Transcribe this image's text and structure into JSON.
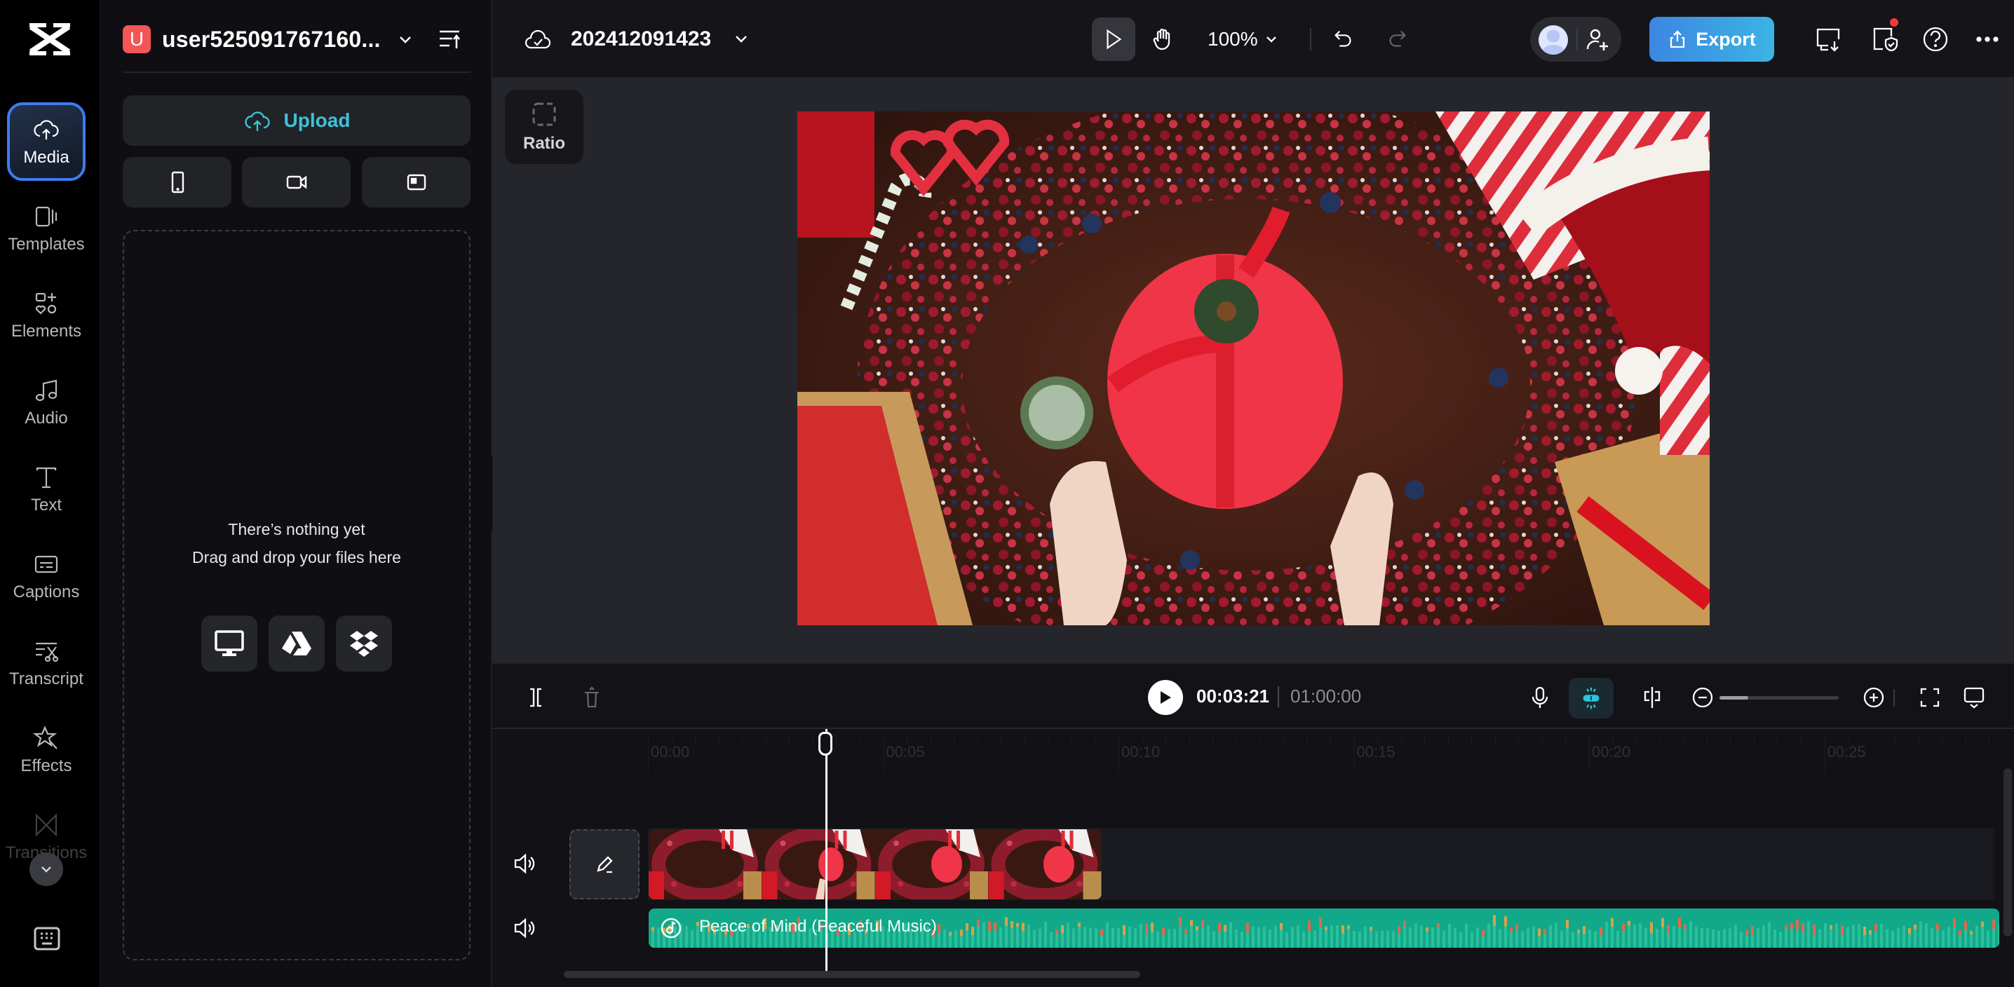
{
  "rail": {
    "items": [
      {
        "id": "media",
        "label": "Media",
        "active": true
      },
      {
        "id": "templates",
        "label": "Templates"
      },
      {
        "id": "elements",
        "label": "Elements"
      },
      {
        "id": "audio",
        "label": "Audio"
      },
      {
        "id": "text",
        "label": "Text"
      },
      {
        "id": "captions",
        "label": "Captions"
      },
      {
        "id": "transcript",
        "label": "Transcript"
      },
      {
        "id": "effects",
        "label": "Effects"
      },
      {
        "id": "transitions",
        "label": "Transitions"
      }
    ],
    "more_icon": "chevron-down-icon",
    "keyboard_icon": "keyboard-shortcuts-icon"
  },
  "panel": {
    "account": {
      "initial": "U",
      "name": "user525091767160...",
      "badge_color": "#f25656"
    },
    "upload_label": "Upload",
    "source_buttons": [
      "phone-icon",
      "record-video-icon",
      "screen-record-icon"
    ],
    "empty_title": "There’s nothing yet",
    "empty_subtitle": "Drag and drop your files here",
    "import_sources": [
      "computer-icon",
      "google-drive-icon",
      "dropbox-icon"
    ]
  },
  "topbar": {
    "project_name": "202412091423",
    "zoom_level": "100%",
    "export_label": "Export",
    "accent": "#3bb4e4"
  },
  "canvas": {
    "ratio_label": "Ratio"
  },
  "playback": {
    "current_time": "00:03:21",
    "total_time": "01:00:00",
    "zoom_slider_fraction": 0.24
  },
  "timeline": {
    "ruler_labels": [
      "00:00",
      "00:05",
      "00:10",
      "00:15",
      "00:20",
      "00:25"
    ],
    "audio_clip_name": "Peace of Mind (Peaceful Music)",
    "audio_color": "#12a88a",
    "playhead_seconds": 3.7
  }
}
